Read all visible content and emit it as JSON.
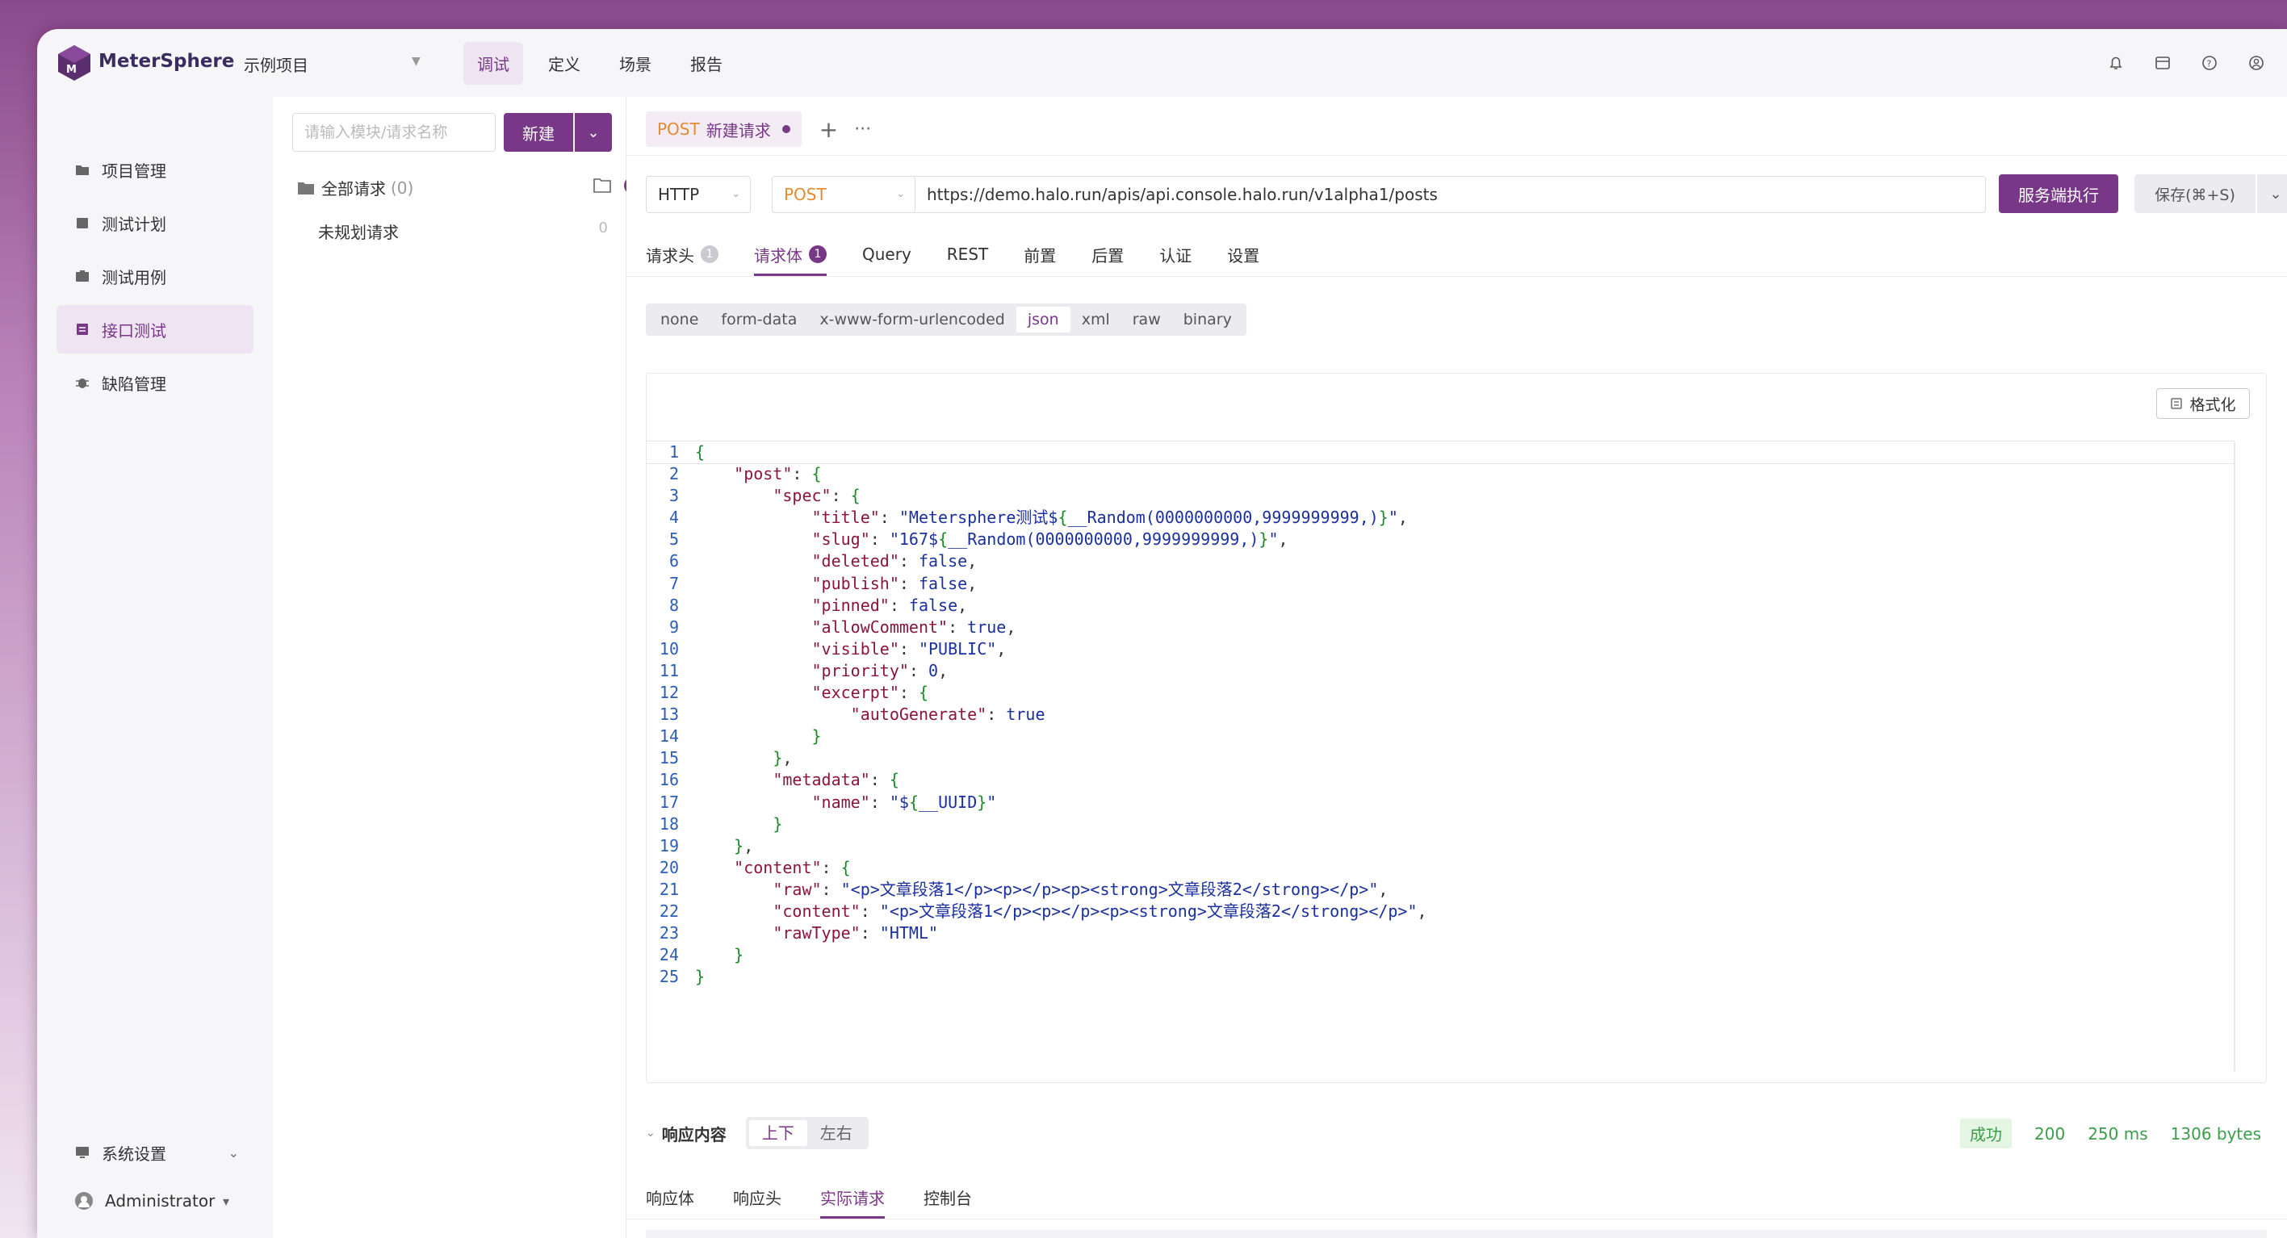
{
  "app": {
    "brand": "MeterSphere",
    "project": "示例项目",
    "nav": [
      "调试",
      "定义",
      "场景",
      "报告"
    ],
    "nav_active": 0,
    "accent": "#783887"
  },
  "sidebar": {
    "items": [
      {
        "label": "项目管理",
        "icon": "folder-icon"
      },
      {
        "label": "测试计划",
        "icon": "calendar-icon"
      },
      {
        "label": "测试用例",
        "icon": "case-icon"
      },
      {
        "label": "接口测试",
        "icon": "api-icon"
      },
      {
        "label": "缺陷管理",
        "icon": "bug-icon"
      }
    ],
    "active": 3,
    "settings_label": "系统设置",
    "user_label": "Administrator"
  },
  "tree": {
    "search_placeholder": "请输入模块/请求名称",
    "new_label": "新建",
    "all_label": "全部请求",
    "all_count": "(0)",
    "child_label": "未规划请求",
    "child_count": "0"
  },
  "request": {
    "tab_method": "POST",
    "tab_name": "新建请求",
    "protocol": "HTTP",
    "method": "POST",
    "url": "https://demo.halo.run/apis/api.console.halo.run/v1alpha1/posts",
    "run_label": "服务端执行",
    "save_label": "保存(⌘+S)",
    "subtabs": [
      {
        "label": "请求头",
        "badge": "1"
      },
      {
        "label": "请求体",
        "badge": "1"
      },
      {
        "label": "Query",
        "badge": ""
      },
      {
        "label": "REST",
        "badge": ""
      },
      {
        "label": "前置",
        "badge": ""
      },
      {
        "label": "后置",
        "badge": ""
      },
      {
        "label": "认证",
        "badge": ""
      },
      {
        "label": "设置",
        "badge": ""
      }
    ],
    "subtab_active": 1,
    "body_types": [
      "none",
      "form-data",
      "x-www-form-urlencoded",
      "json",
      "xml",
      "raw",
      "binary"
    ],
    "body_type_active": 3,
    "format_label": "格式化"
  },
  "code_lines": [
    "{",
    "    \"post\": {",
    "        \"spec\": {",
    "            \"title\": \"Metersphere测试${__Random(0000000000,9999999999,)}\",",
    "            \"slug\": \"167${__Random(0000000000,9999999999,)}\",",
    "            \"deleted\": false,",
    "            \"publish\": false,",
    "            \"pinned\": false,",
    "            \"allowComment\": true,",
    "            \"visible\": \"PUBLIC\",",
    "            \"priority\": 0,",
    "            \"excerpt\": {",
    "                \"autoGenerate\": true",
    "            }",
    "        },",
    "        \"metadata\": {",
    "            \"name\": \"${__UUID}\"",
    "        }",
    "    },",
    "    \"content\": {",
    "        \"raw\": \"<p>文章段落1</p><p></p><p><strong>文章段落2</strong></p>\",",
    "        \"content\": \"<p>文章段落1</p><p></p><p><strong>文章段落2</strong></p>\",",
    "        \"rawType\": \"HTML\"",
    "    }",
    "}"
  ],
  "response": {
    "title": "响应内容",
    "layout_options": [
      "上下",
      "左右"
    ],
    "layout_active": 0,
    "status": "成功",
    "code": "200",
    "time": "250 ms",
    "size": "1306 bytes",
    "tabs": [
      "响应体",
      "响应头",
      "实际请求",
      "控制台"
    ],
    "tab_active": 2
  }
}
